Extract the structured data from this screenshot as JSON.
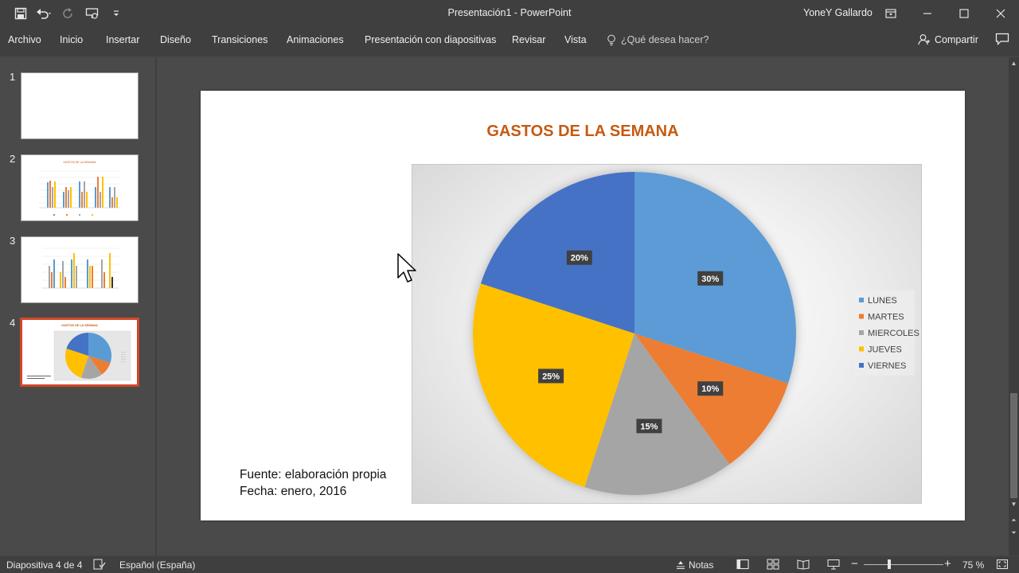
{
  "titlebar": {
    "doc_title": "Presentación1  -  PowerPoint",
    "user": "YoneY Gallardo"
  },
  "ribbon": {
    "tabs": [
      "Archivo",
      "Inicio",
      "Insertar",
      "Diseño",
      "Transiciones",
      "Animaciones",
      "Presentación con diapositivas",
      "Revisar",
      "Vista"
    ],
    "tell_me": "¿Qué desea hacer?",
    "share": "Compartir"
  },
  "thumbnails": {
    "numbers": [
      "1",
      "2",
      "3",
      "4"
    ],
    "mini_title": "GASTOS DE LA SEMANA"
  },
  "slide": {
    "title": "GASTOS DE LA SEMANA",
    "source_line1": "Fuente: elaboración propia",
    "source_line2": "Fecha: enero, 2016"
  },
  "chart_data": {
    "type": "pie",
    "categories": [
      "LUNES",
      "MARTES",
      "MIERCOLES",
      "JUEVES",
      "VIERNES"
    ],
    "values": [
      30,
      10,
      15,
      25,
      20
    ],
    "labels": [
      "30%",
      "10%",
      "15%",
      "25%",
      "20%"
    ],
    "colors": [
      "#5b9bd5",
      "#ed7d31",
      "#a5a5a5",
      "#ffc000",
      "#4472c4"
    ],
    "legend": "right",
    "title": ""
  },
  "statusbar": {
    "slide_info": "Diapositiva 4 de 4",
    "language": "Español (España)",
    "notes": "Notas",
    "zoom": "75 %"
  }
}
